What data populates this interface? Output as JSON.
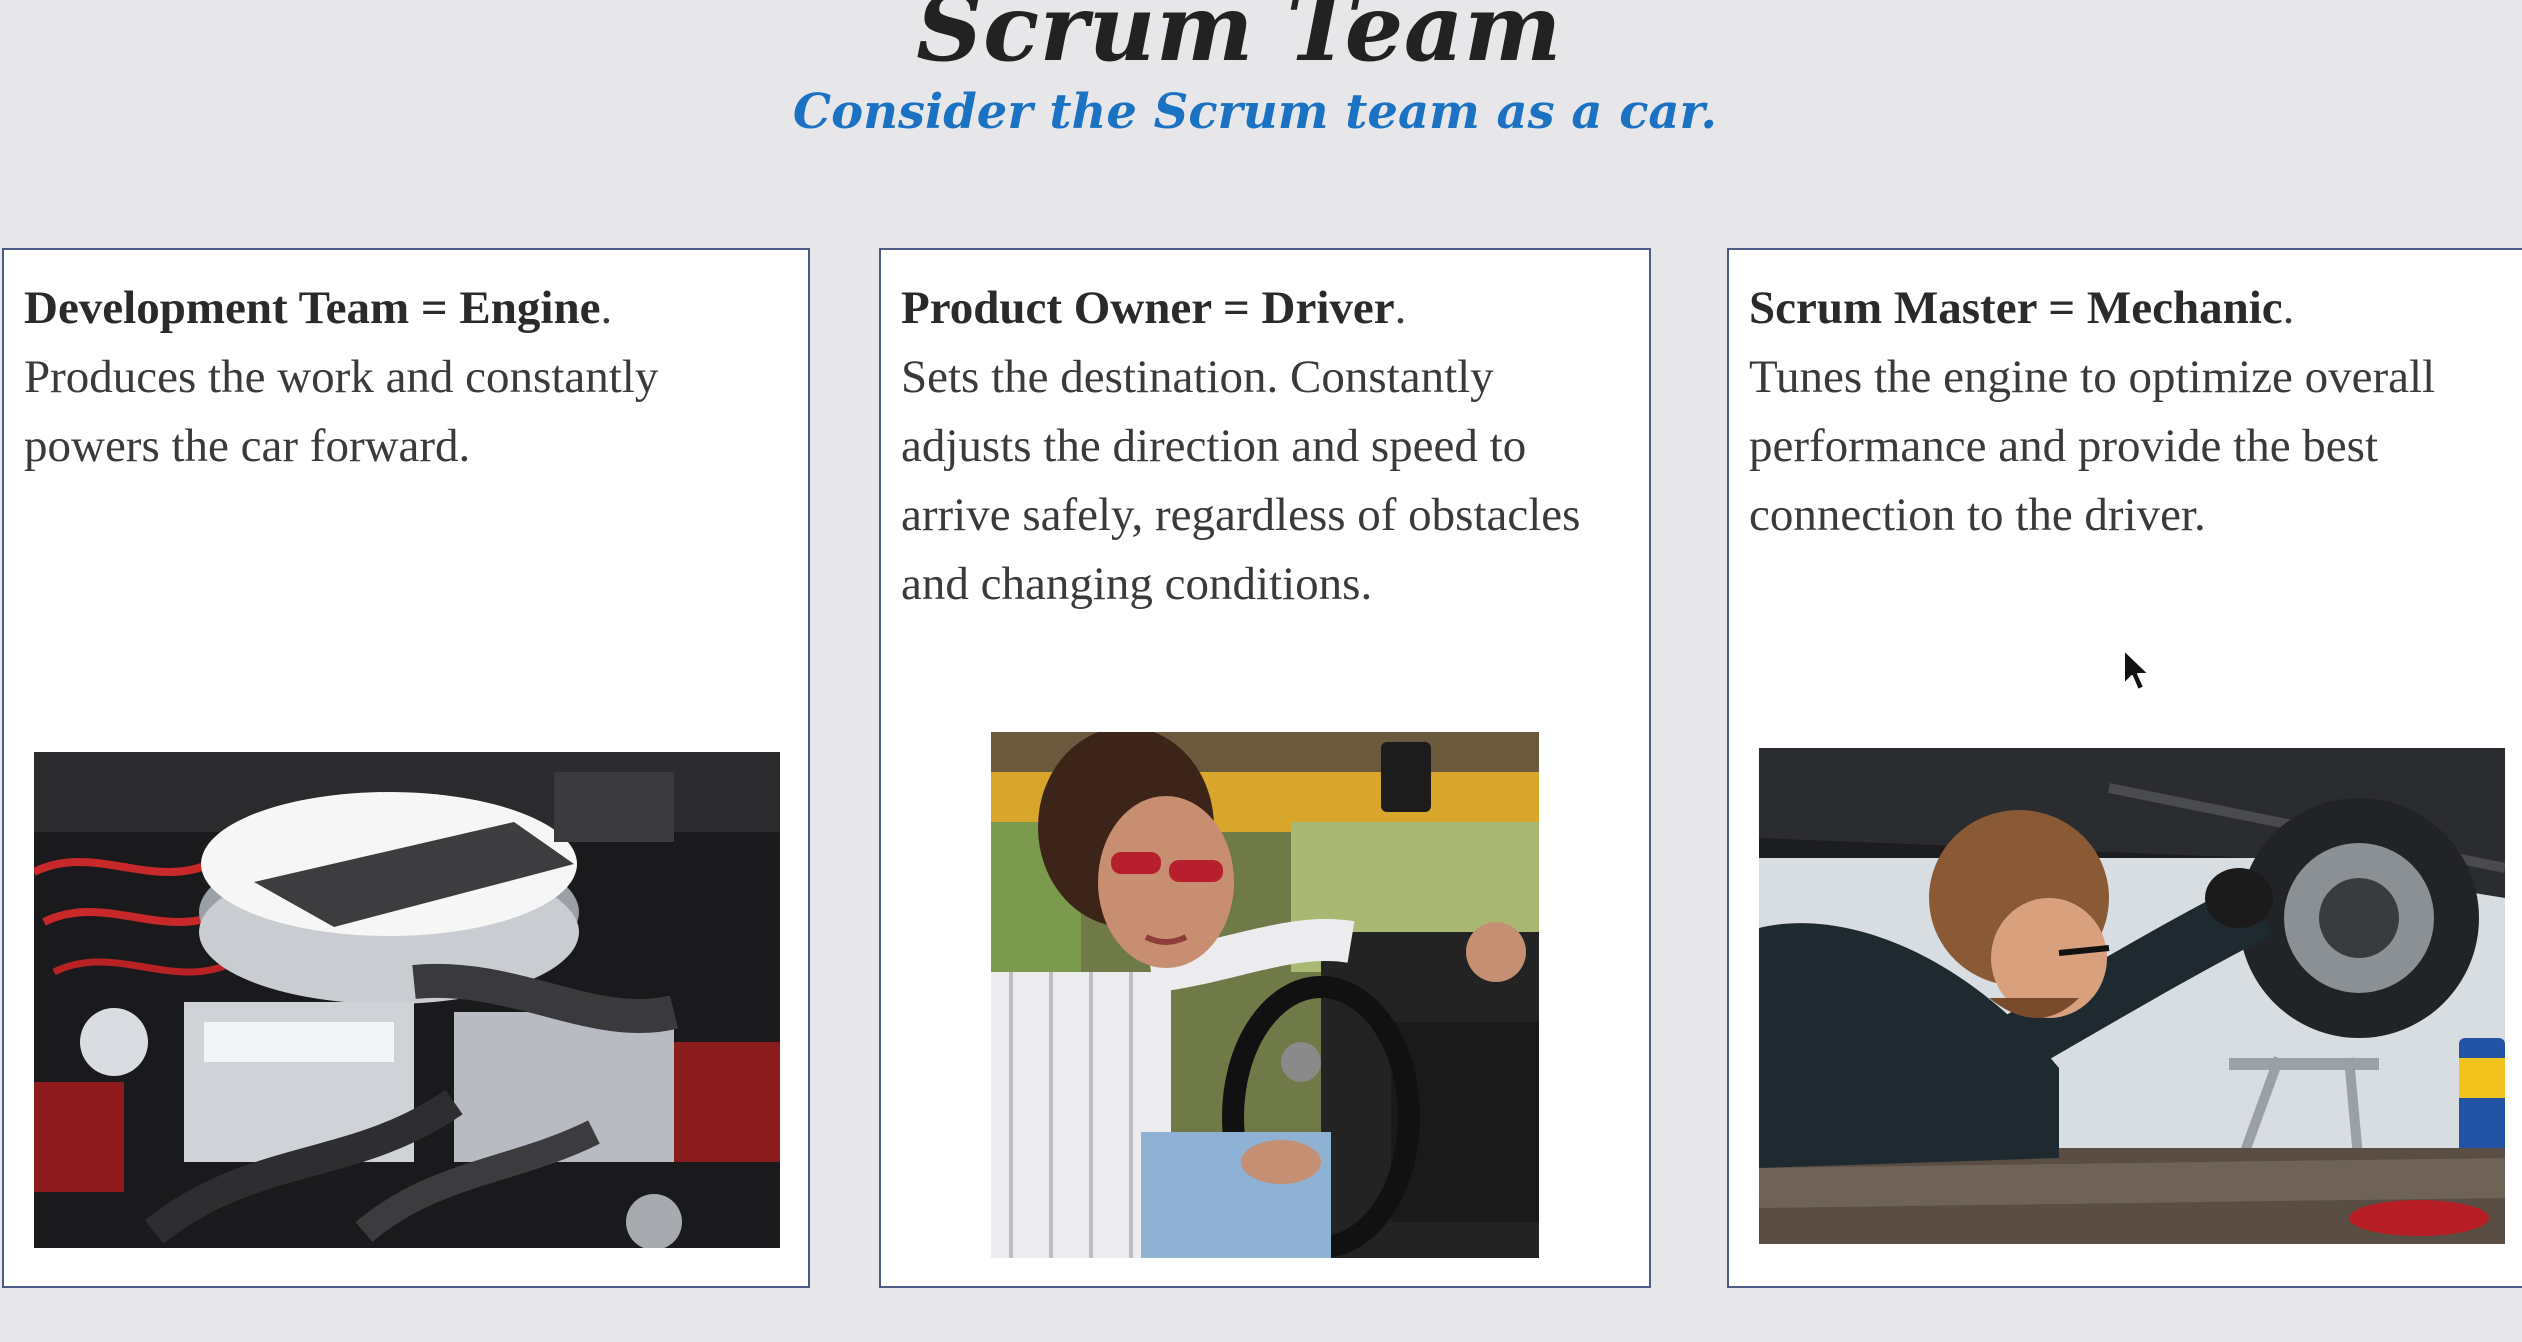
{
  "slide": {
    "title": "Scrum Team",
    "subtitle": "Consider the Scrum team as a car."
  },
  "cards": [
    {
      "heading": "Development Team = Engine",
      "punct": ".",
      "body": "Produces the work and constantly powers the car forward.",
      "image": "car-engine-photo"
    },
    {
      "heading": "Product Owner = Driver",
      "punct": ".",
      "body": "Sets the destination. Constantly adjusts the direction and speed to arrive safely, regardless of obstacles and changing conditions.",
      "image": "driver-photo"
    },
    {
      "heading": "Scrum Master = Mechanic",
      "punct": ".",
      "body": "Tunes the engine to optimize overall performance and provide the best connection to the driver.",
      "image": "mechanic-photo"
    }
  ],
  "colors": {
    "background": "#e7e7ea",
    "title": "#222222",
    "subtitle": "#1b72c2",
    "card_border": "#4b5a89"
  },
  "icons": {
    "cursor": "mouse-pointer-icon"
  }
}
